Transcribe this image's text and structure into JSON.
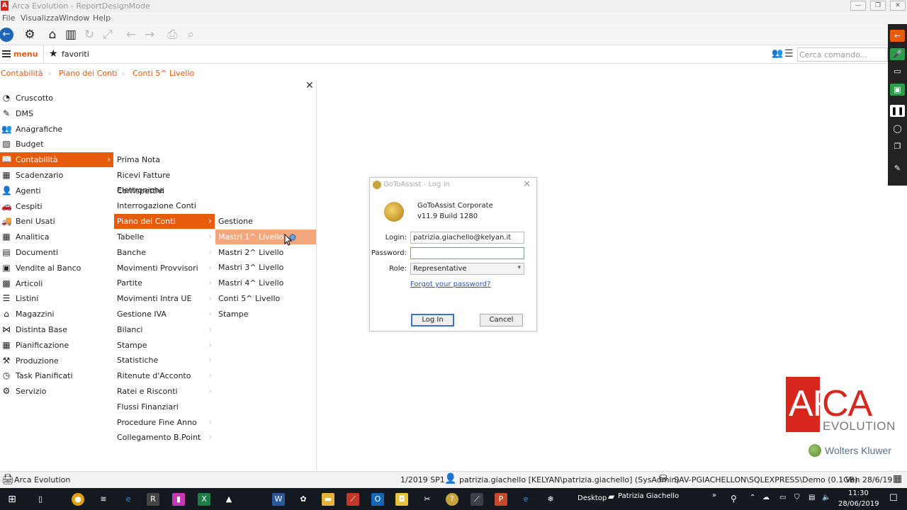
{
  "window": {
    "title": "Arca Evolution - ReportDesignMode",
    "app_letter": "A"
  },
  "menubar": {
    "items": [
      "File",
      "Visualizza",
      "Window",
      "Help"
    ]
  },
  "nav": {
    "menu_label": "menu",
    "favorites_label": "favoriti",
    "search_placeholder": "Cerca comando..."
  },
  "breadcrumb": [
    "Contabilità",
    "Piano dei Conti",
    "Conti  5^ Livello"
  ],
  "menu_level1": [
    {
      "label": "Cruscotto",
      "icon": "gauge-icon"
    },
    {
      "label": "DMS",
      "icon": "clip-icon"
    },
    {
      "label": "Anagrafiche",
      "icon": "people-icon"
    },
    {
      "label": "Budget",
      "icon": "chart-icon"
    },
    {
      "label": "Contabilità",
      "icon": "book-icon"
    },
    {
      "label": "Scadenzario",
      "icon": "table-icon"
    },
    {
      "label": "Agenti",
      "icon": "person-icon"
    },
    {
      "label": "Cespiti",
      "icon": "car-icon"
    },
    {
      "label": "Beni Usati",
      "icon": "truck-icon"
    },
    {
      "label": "Analitica",
      "icon": "grid-icon"
    },
    {
      "label": "Documenti",
      "icon": "document-icon"
    },
    {
      "label": "Vendite al Banco",
      "icon": "register-icon"
    },
    {
      "label": "Articoli",
      "icon": "cube-icon"
    },
    {
      "label": "Listini",
      "icon": "list-icon"
    },
    {
      "label": "Magazzini",
      "icon": "warehouse-icon"
    },
    {
      "label": "Distinta Base",
      "icon": "hierarchy-icon"
    },
    {
      "label": "Pianificazione",
      "icon": "calendar-icon"
    },
    {
      "label": "Produzione",
      "icon": "factory-icon"
    },
    {
      "label": "Task Pianificati",
      "icon": "clock-icon"
    },
    {
      "label": "Servizio",
      "icon": "gear-icon"
    }
  ],
  "menu_level2": [
    {
      "label": "Prima Nota",
      "chevron": ""
    },
    {
      "label": "Ricevi Fatture Elettroniche",
      "chevron": ""
    },
    {
      "label": "Corrispettivi",
      "chevron": ""
    },
    {
      "label": "Interrogazione Conti",
      "chevron": ""
    },
    {
      "label": "Piano dei Conti",
      "chevron": "›"
    },
    {
      "label": "Tabelle",
      "chevron": "›"
    },
    {
      "label": "Banche",
      "chevron": "›"
    },
    {
      "label": "Movimenti Provvisori",
      "chevron": "›"
    },
    {
      "label": "Partite",
      "chevron": "›"
    },
    {
      "label": "Movimenti Intra UE",
      "chevron": "›"
    },
    {
      "label": "Gestione IVA",
      "chevron": "›"
    },
    {
      "label": "Bilanci",
      "chevron": "›"
    },
    {
      "label": "Stampe",
      "chevron": "›"
    },
    {
      "label": "Statistiche",
      "chevron": "›"
    },
    {
      "label": "Ritenute d'Acconto",
      "chevron": "›"
    },
    {
      "label": "Ratei e Risconti",
      "chevron": "›"
    },
    {
      "label": "Flussi Finanziari",
      "chevron": ""
    },
    {
      "label": "Procedure Fine Anno",
      "chevron": "›"
    },
    {
      "label": "Collegamento B.Point",
      "chevron": "›"
    }
  ],
  "menu_level3": [
    {
      "label": "Gestione"
    },
    {
      "label": "Mastri 1^ Livello"
    },
    {
      "label": "Mastri 2^ Livello"
    },
    {
      "label": "Mastri 3^ Livello"
    },
    {
      "label": "Mastri 4^ Livello"
    },
    {
      "label": "Conti  5^ Livello"
    },
    {
      "label": "Stampe"
    }
  ],
  "dialog": {
    "title": "GoToAssist - Log In",
    "product": "GoToAssist Corporate",
    "version": "v11.9 Build 1280",
    "login_label": "Login:",
    "login_value": "patrizia.giachello@kelyan.it",
    "password_label": "Password:",
    "password_value": "",
    "role_label": "Role:",
    "role_value": "Representative",
    "forgot": "Forgot your password?",
    "login_btn": "Log In",
    "cancel_btn": "Cancel"
  },
  "logo": {
    "arca_a": "AR",
    "arca_b": "CA",
    "evolution": "EVOLUTION",
    "wk": "Wolters Kluwer"
  },
  "status": {
    "app": "Arca Evolution",
    "version": "1/2019 SP1",
    "user": "patrizia.giachello [KELYAN\\patrizia.giachello] (SysAdmin)",
    "db": "SAV-PGIACHELLON\\SQLEXPRESS\\Demo (0.1GB)",
    "date": "Ven 28/6/19"
  },
  "taskbar": {
    "desktop_label": "Desktop",
    "user_label": "Patrizia Giachello",
    "time": "11:30",
    "date": "28/06/2019"
  },
  "colors": {
    "accent": "#e85a0c",
    "accent_light": "#f4a77c",
    "brand_red": "#d8261f",
    "link": "#2a52c9"
  }
}
